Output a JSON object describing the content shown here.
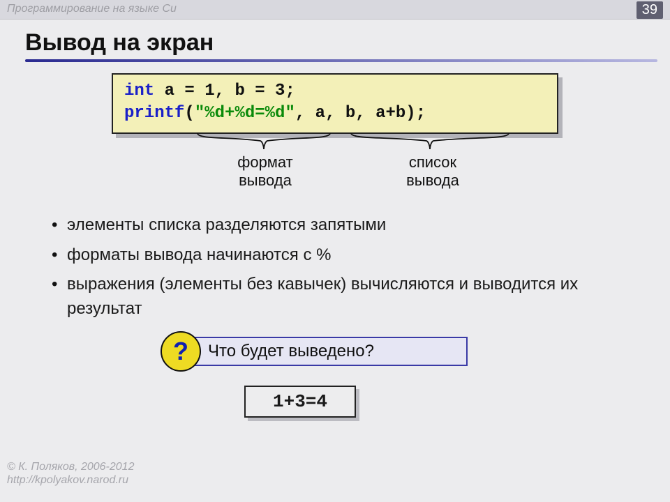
{
  "header": {
    "topic": "Программирование на языке Си",
    "page_number": "39"
  },
  "title": "Вывод на экран",
  "code": {
    "line1": {
      "kw": "int",
      "rest": " a = 1, b = 3;"
    },
    "line2": {
      "kw": "printf",
      "open": "(",
      "str": "\"%d+%d=%d\"",
      "rest": ", a, b, a+b);"
    }
  },
  "annotations": {
    "format": {
      "l1": "формат",
      "l2": "вывода"
    },
    "list": {
      "l1": "список",
      "l2": "вывода"
    }
  },
  "bullets": [
    "элементы списка разделяются запятыми",
    "форматы вывода начинаются с %",
    "выражения (элементы без кавычек) вычисляются и выводится их результат"
  ],
  "question": {
    "mark": "?",
    "text": "Что будет выведено?"
  },
  "answer": "1+3=4",
  "footer": {
    "author": "© К. Поляков, 2006-2012",
    "url": "http://kpolyakov.narod.ru"
  }
}
